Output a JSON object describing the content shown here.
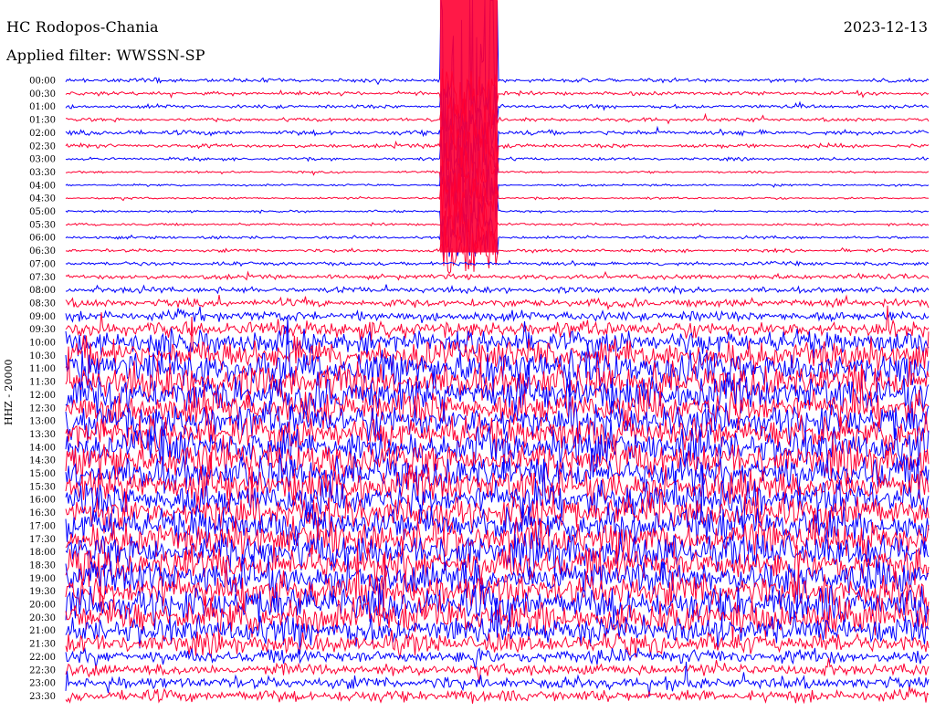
{
  "header": {
    "station": "HC Rodopos-Chania",
    "date": "2023-12-13",
    "filter_label": "Applied filter: WWSSN-SP",
    "channel": "HHZ - 20000"
  },
  "colors": {
    "even_rows": "#0000ff",
    "odd_rows": "#ff0033"
  },
  "chart_data": {
    "type": "line",
    "title": "HC Rodopos-Chania",
    "ylabel": "HHZ - 20000",
    "row_labels": [
      "00:00",
      "00:30",
      "01:00",
      "01:30",
      "02:00",
      "02:30",
      "03:00",
      "03:30",
      "04:00",
      "04:30",
      "05:00",
      "05:30",
      "06:00",
      "06:30",
      "07:00",
      "07:30",
      "08:00",
      "08:30",
      "09:00",
      "09:30",
      "10:00",
      "10:30",
      "11:00",
      "11:30",
      "12:00",
      "12:30",
      "13:00",
      "13:30",
      "14:00",
      "14:30",
      "15:00",
      "15:30",
      "16:00",
      "16:30",
      "17:00",
      "17:30",
      "18:00",
      "18:30",
      "19:00",
      "19:30",
      "20:00",
      "20:30",
      "21:00",
      "21:30",
      "22:00",
      "22:30",
      "23:00",
      "23:30"
    ],
    "row_minutes": 30,
    "relative_amplitude": [
      1.0,
      0.9,
      0.9,
      0.9,
      1.2,
      1.0,
      0.7,
      0.5,
      0.5,
      0.5,
      0.5,
      0.6,
      0.7,
      0.8,
      1.0,
      1.2,
      1.5,
      2.0,
      2.5,
      4.0,
      6.0,
      8.0,
      9.0,
      9.0,
      9.0,
      9.0,
      9.0,
      9.0,
      9.0,
      9.0,
      9.0,
      9.0,
      9.0,
      9.0,
      9.0,
      9.0,
      9.0,
      9.0,
      9.0,
      9.0,
      9.0,
      9.0,
      7.0,
      5.0,
      3.5,
      3.0,
      3.0,
      3.0
    ],
    "event": {
      "rows": [
        "00:00",
        "00:30",
        "01:00",
        "01:30",
        "02:00",
        "02:30",
        "03:00",
        "03:30",
        "04:00",
        "04:30",
        "05:00",
        "05:30",
        "06:00",
        "06:30"
      ],
      "minute_start": 13.0,
      "minute_end": 15.0
    },
    "legend": "none",
    "grid": false
  }
}
